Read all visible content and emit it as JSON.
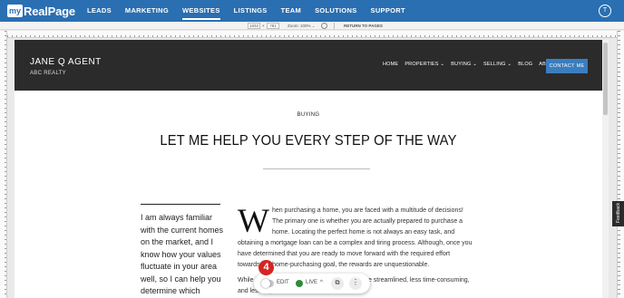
{
  "app": {
    "logo_prefix": "my",
    "logo_name": "RealPage",
    "nav": [
      "LEADS",
      "MARKETING",
      "WEBSITES",
      "LISTINGS",
      "TEAM",
      "SOLUTIONS",
      "SUPPORT"
    ],
    "active_nav": "WEBSITES",
    "user_initial": "T"
  },
  "toolbar": {
    "width": "1832",
    "times": "×",
    "height": "781",
    "zoom": "Zoom: 100% ⌄",
    "return_label": "RETURN TO PAGES"
  },
  "site": {
    "agent_name": "JANE Q AGENT",
    "company": "ABC REALTY",
    "nav": [
      "HOME",
      "PROPERTIES ⌄",
      "BUYING ⌄",
      "SELLING ⌄",
      "BLOG",
      "ABOUT ⌄"
    ],
    "contact_label": "CONTACT ME"
  },
  "content": {
    "kicker": "BUYING",
    "title": "LET ME HELP YOU EVERY STEP OF THE WAY",
    "aside": "I am always familiar with the current homes on the market, and I know how your values fluctuate in your area well, so I can help you determine which",
    "dropcap": "W",
    "body": "hen purchasing a home, you are faced with a multitude of decisions! The primary one is whether you are actually prepared to purchase a home. Locating the perfect home is not always an easy task, and obtaining a mortgage loan can be a complex and tiring process. Although, once you have determined that you are ready to move forward with the required effort towards the home-purchasing goal, the rewards are unquestionable.",
    "body2": "While I make the process of purchasing a home streamlined, less time-consuming, and less expensive than if"
  },
  "feedback_label": "Feedback",
  "editbar": {
    "edit_label": "EDIT",
    "live_label": "LIVE",
    "chevron": "^",
    "open_icon": "⧉",
    "more_icon": "⋮",
    "step_badge": "4"
  }
}
